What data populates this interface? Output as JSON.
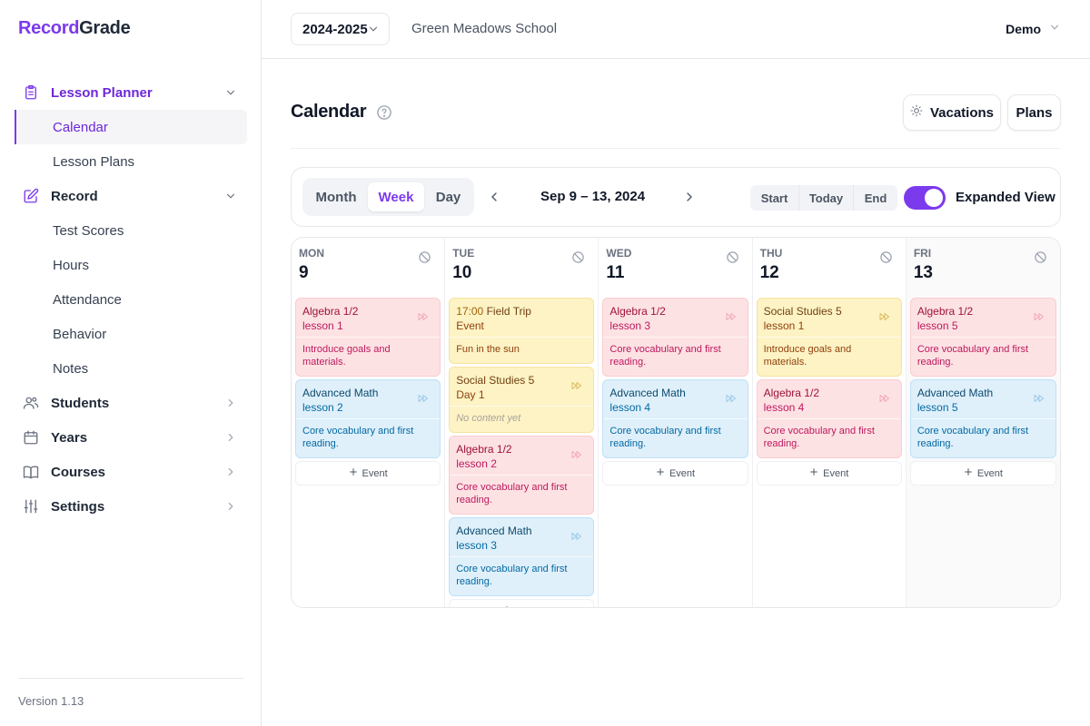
{
  "app": {
    "logo_part1": "Record",
    "logo_part2": "Grade",
    "version": "Version 1.13"
  },
  "sidebar": {
    "lesson_planner": {
      "label": "Lesson Planner",
      "items": [
        "Calendar",
        "Lesson Plans"
      ]
    },
    "record": {
      "label": "Record",
      "items": [
        "Test Scores",
        "Hours",
        "Attendance",
        "Behavior",
        "Notes"
      ]
    },
    "sections": [
      "Students",
      "Years",
      "Courses",
      "Settings"
    ]
  },
  "header": {
    "year": "2024-2025",
    "school": "Green Meadows School",
    "user": "Demo"
  },
  "page": {
    "title": "Calendar",
    "vacations": "Vacations",
    "plans": "Plans"
  },
  "toolbar": {
    "views": [
      "Month",
      "Week",
      "Day"
    ],
    "range": "Sep 9 – 13, 2024",
    "jump": [
      "Start",
      "Today",
      "End"
    ],
    "toggle_label": "Expanded View",
    "expanded": true
  },
  "add_event_label": "Event",
  "days": [
    {
      "dow": "MON",
      "num": "9",
      "cards": [
        {
          "color": "red",
          "title": "Algebra 1/2",
          "sub": "lesson 1",
          "desc": "Introduce goals and materials."
        },
        {
          "color": "blue",
          "title": "Advanced Math",
          "sub": "lesson 2",
          "desc": "Core vocabulary and first reading."
        }
      ]
    },
    {
      "dow": "TUE",
      "num": "10",
      "cards": [
        {
          "color": "yellow",
          "time": "17:00",
          "title": "Field Trip",
          "sub": "Event",
          "desc": "Fun in the sun"
        },
        {
          "color": "yellow",
          "title": "Social Studies 5",
          "sub": "Day 1",
          "desc": "No content yet",
          "empty": true
        },
        {
          "color": "red",
          "title": "Algebra 1/2",
          "sub": "lesson 2",
          "desc": "Core vocabulary and first reading."
        },
        {
          "color": "blue",
          "title": "Advanced Math",
          "sub": "lesson 3",
          "desc": "Core vocabulary and first reading."
        }
      ]
    },
    {
      "dow": "WED",
      "num": "11",
      "cards": [
        {
          "color": "red",
          "title": "Algebra 1/2",
          "sub": "lesson 3",
          "desc": "Core vocabulary and first reading."
        },
        {
          "color": "blue",
          "title": "Advanced Math",
          "sub": "lesson 4",
          "desc": "Core vocabulary and first reading."
        }
      ]
    },
    {
      "dow": "THU",
      "num": "12",
      "cards": [
        {
          "color": "yellow",
          "title": "Social Studies 5",
          "sub": "lesson 1",
          "desc": "Introduce goals and materials."
        },
        {
          "color": "red",
          "title": "Algebra 1/2",
          "sub": "lesson 4",
          "desc": "Core vocabulary and first reading."
        }
      ]
    },
    {
      "dow": "FRI",
      "num": "13",
      "cards": [
        {
          "color": "red",
          "title": "Algebra 1/2",
          "sub": "lesson 5",
          "desc": "Core vocabulary and first reading."
        },
        {
          "color": "blue",
          "title": "Advanced Math",
          "sub": "lesson 5",
          "desc": "Core vocabulary and first reading."
        }
      ]
    }
  ]
}
